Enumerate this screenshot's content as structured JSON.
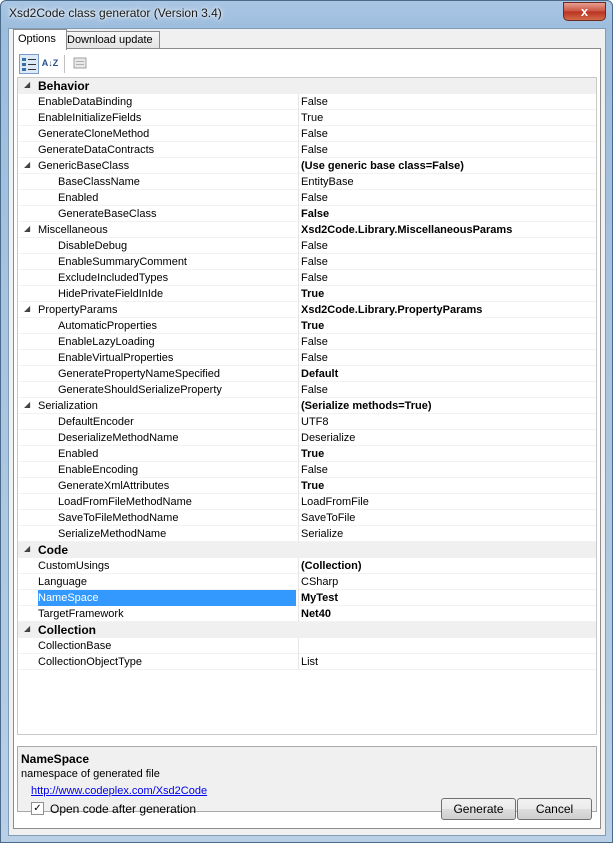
{
  "window": {
    "title": "Xsd2Code class generator (Version 3.4)",
    "close_glyph": "x"
  },
  "tabs": [
    {
      "label": "Options",
      "active": true
    },
    {
      "label": "Download update",
      "active": false
    }
  ],
  "toolbar": {
    "categorized_icon": "categorized-view-icon",
    "alphabetical_label": "A↓Z",
    "pages_icon": "property-pages-icon"
  },
  "grid": [
    {
      "type": "cat",
      "name": "Behavior"
    },
    {
      "type": "prop",
      "name": "EnableDataBinding",
      "value": "False"
    },
    {
      "type": "prop",
      "name": "EnableInitializeFields",
      "value": "True"
    },
    {
      "type": "prop",
      "name": "GenerateCloneMethod",
      "value": "False"
    },
    {
      "type": "prop",
      "name": "GenerateDataContracts",
      "value": "False"
    },
    {
      "type": "group",
      "name": "GenericBaseClass",
      "value": "(Use generic base class=False)",
      "bold": true
    },
    {
      "type": "sub",
      "name": "BaseClassName",
      "value": "EntityBase"
    },
    {
      "type": "sub",
      "name": "Enabled",
      "value": "False"
    },
    {
      "type": "sub",
      "name": "GenerateBaseClass",
      "value": "False",
      "bold": true
    },
    {
      "type": "group",
      "name": "Miscellaneous",
      "value": "Xsd2Code.Library.MiscellaneousParams",
      "bold": true
    },
    {
      "type": "sub",
      "name": "DisableDebug",
      "value": "False"
    },
    {
      "type": "sub",
      "name": "EnableSummaryComment",
      "value": "False"
    },
    {
      "type": "sub",
      "name": "ExcludeIncludedTypes",
      "value": "False"
    },
    {
      "type": "sub",
      "name": "HidePrivateFieldInIde",
      "value": "True",
      "bold": true
    },
    {
      "type": "group",
      "name": "PropertyParams",
      "value": "Xsd2Code.Library.PropertyParams",
      "bold": true
    },
    {
      "type": "sub",
      "name": "AutomaticProperties",
      "value": "True",
      "bold": true
    },
    {
      "type": "sub",
      "name": "EnableLazyLoading",
      "value": "False"
    },
    {
      "type": "sub",
      "name": "EnableVirtualProperties",
      "value": "False"
    },
    {
      "type": "sub",
      "name": "GeneratePropertyNameSpecified",
      "value": "Default",
      "bold": true
    },
    {
      "type": "sub",
      "name": "GenerateShouldSerializeProperty",
      "value": "False"
    },
    {
      "type": "group",
      "name": "Serialization",
      "value": "(Serialize methods=True)",
      "bold": true
    },
    {
      "type": "sub",
      "name": "DefaultEncoder",
      "value": "UTF8"
    },
    {
      "type": "sub",
      "name": "DeserializeMethodName",
      "value": "Deserialize"
    },
    {
      "type": "sub",
      "name": "Enabled",
      "value": "True",
      "bold": true
    },
    {
      "type": "sub",
      "name": "EnableEncoding",
      "value": "False"
    },
    {
      "type": "sub",
      "name": "GenerateXmlAttributes",
      "value": "True",
      "bold": true
    },
    {
      "type": "sub",
      "name": "LoadFromFileMethodName",
      "value": "LoadFromFile"
    },
    {
      "type": "sub",
      "name": "SaveToFileMethodName",
      "value": "SaveToFile"
    },
    {
      "type": "sub",
      "name": "SerializeMethodName",
      "value": "Serialize"
    },
    {
      "type": "cat",
      "name": "Code"
    },
    {
      "type": "prop",
      "name": "CustomUsings",
      "value": "(Collection)",
      "bold": true
    },
    {
      "type": "prop",
      "name": "Language",
      "value": "CSharp"
    },
    {
      "type": "prop",
      "name": "NameSpace",
      "value": "MyTest",
      "bold": true,
      "selected": true
    },
    {
      "type": "prop",
      "name": "TargetFramework",
      "value": "Net40",
      "bold": true
    },
    {
      "type": "cat",
      "name": "Collection"
    },
    {
      "type": "prop",
      "name": "CollectionBase",
      "value": ""
    },
    {
      "type": "prop",
      "name": "CollectionObjectType",
      "value": "List"
    }
  ],
  "description": {
    "title": "NameSpace",
    "text": "namespace of generated file"
  },
  "footer": {
    "link": "http://www.codeplex.com/Xsd2Code",
    "checkbox_label": "Open code after generation",
    "checkbox_checked": true,
    "check_glyph": "✓",
    "generate_label": "Generate",
    "cancel_label": "Cancel"
  },
  "expander_glyph": "◢"
}
